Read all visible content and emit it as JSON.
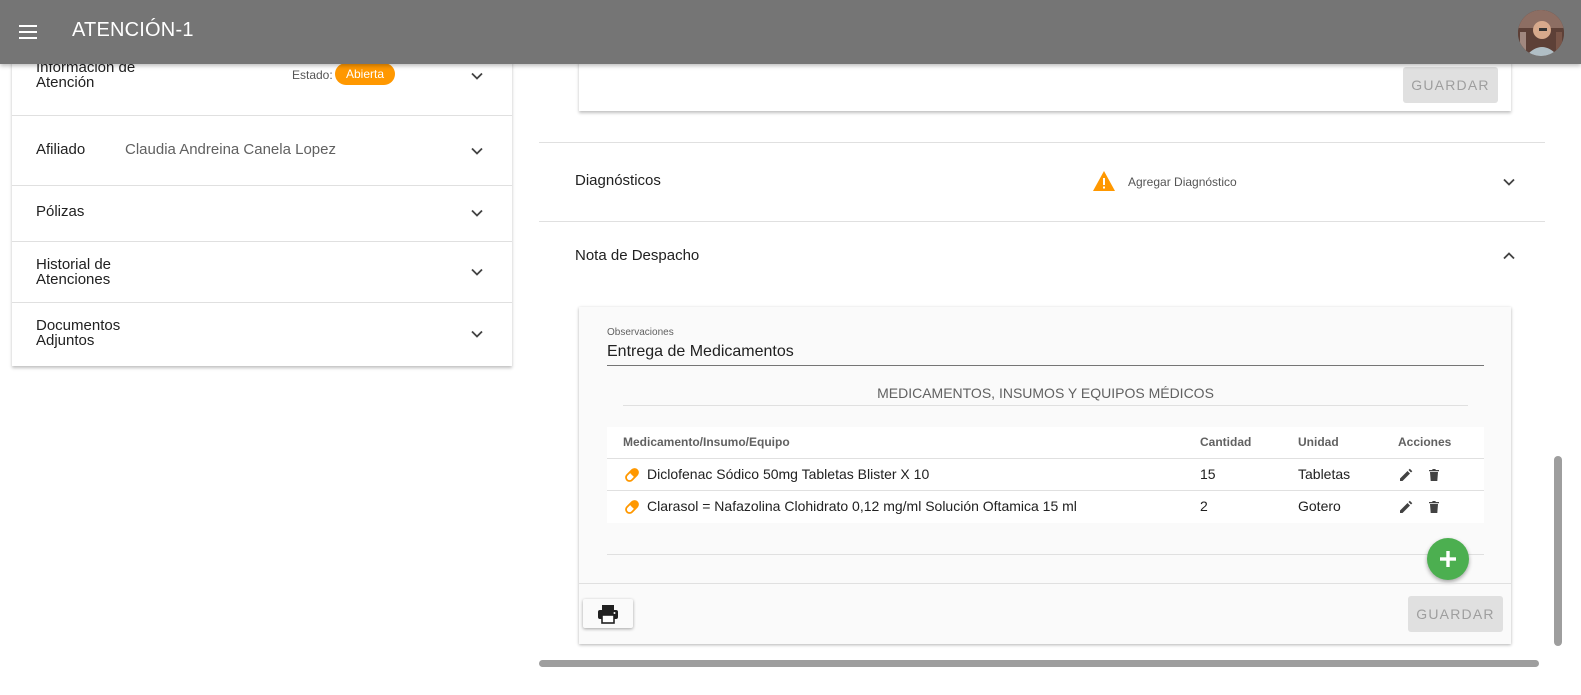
{
  "appbar": {
    "title": "ATENCIÓN-1"
  },
  "left_panel": {
    "info": {
      "label": "Información de Atención",
      "estado_label": "Estado:",
      "estado_value": "Abierta"
    },
    "afiliado": {
      "label": "Afiliado",
      "name": "Claudia Andreina Canela Lopez"
    },
    "polizas": {
      "label": "Pólizas"
    },
    "historial": {
      "label": "Historial de Atenciones"
    },
    "documentos": {
      "label": "Documentos Adjuntos"
    }
  },
  "right_panel": {
    "top_card": {
      "save_label": "GUARDAR"
    },
    "diagnosticos": {
      "title": "Diagnósticos",
      "add_label": "Agregar Diagnóstico"
    },
    "despacho": {
      "title": "Nota de Despacho",
      "observaciones_label": "Observaciones",
      "observaciones_value": "Entrega de Medicamentos",
      "section_title": "MEDICAMENTOS, INSUMOS Y EQUIPOS MÉDICOS",
      "table": {
        "headers": [
          "Medicamento/Insumo/Equipo",
          "Cantidad",
          "Unidad",
          "Acciones"
        ],
        "rows": [
          {
            "name": "Diclofenac Sódico 50mg Tabletas Blister X 10",
            "cantidad": "15",
            "unidad": "Tabletas"
          },
          {
            "name": "Clarasol = Nafazolina Clohidrato 0,12 mg/ml Solución Oftamica 15 ml",
            "cantidad": "2",
            "unidad": "Gotero"
          }
        ]
      },
      "save_label": "GUARDAR"
    }
  },
  "colors": {
    "appbar": "#757575",
    "badge": "#ff9800",
    "warning": "#ff9800",
    "fab": "#4caf50",
    "pill": "#ff9800"
  },
  "icons": [
    "menu-icon",
    "chevron-down-icon",
    "chevron-up-icon",
    "warning-icon",
    "pill-icon",
    "edit-icon",
    "delete-icon",
    "add-icon",
    "print-icon"
  ]
}
